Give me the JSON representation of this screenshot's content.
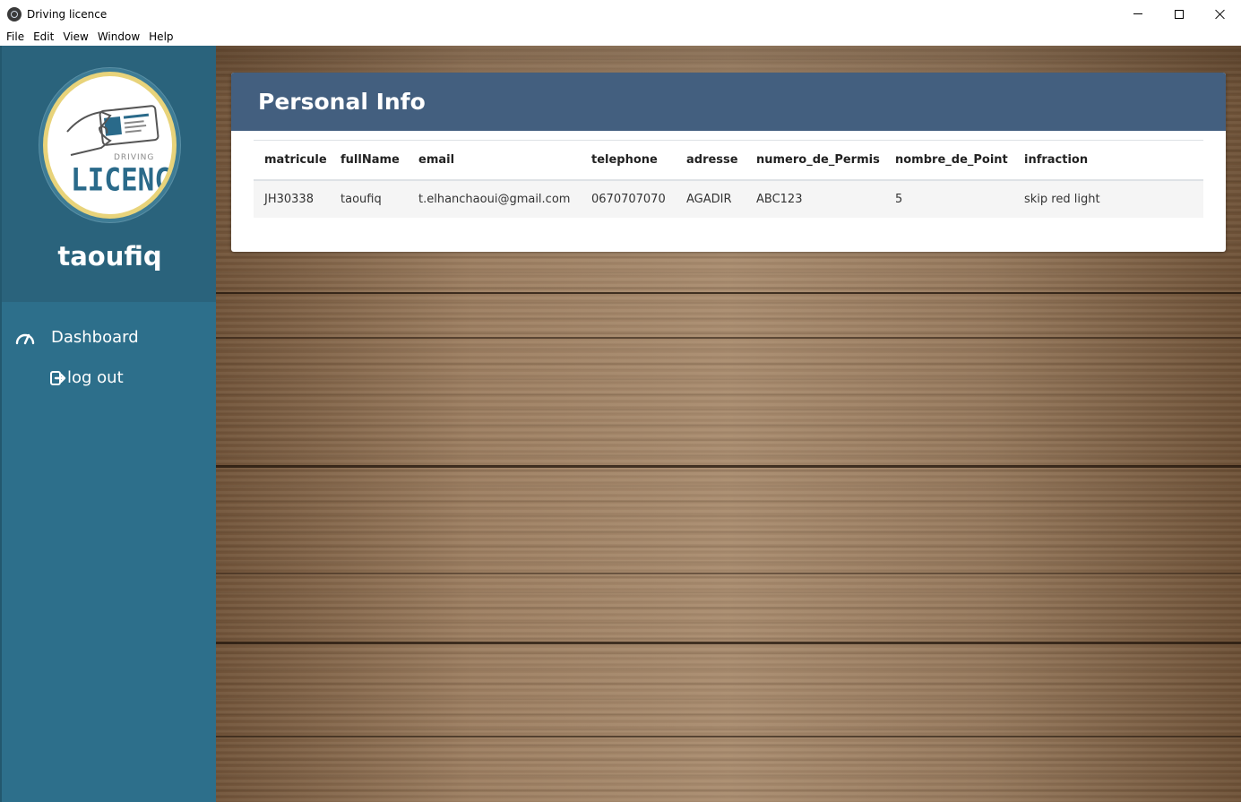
{
  "window": {
    "title": "Driving licence",
    "menu": [
      "File",
      "Edit",
      "View",
      "Window",
      "Help"
    ]
  },
  "sidebar": {
    "logo": {
      "top_text": "DRIVING",
      "main_text": "LICENCE"
    },
    "username": "taoufiq",
    "nav": [
      {
        "label": "Dashboard",
        "icon": "dashboard-gauge-icon"
      },
      {
        "label": "log out",
        "icon": "sign-out-icon"
      }
    ]
  },
  "card": {
    "title": "Personal Info",
    "columns": [
      "matricule",
      "fullName",
      "email",
      "telephone",
      "adresse",
      "numero_de_Permis",
      "nombre_de_Point",
      "infraction"
    ],
    "rows": [
      [
        "JH30338",
        "taoufiq",
        "t.elhanchaoui@gmail.com",
        "0670707070",
        "AGADIR",
        "ABC123",
        "5",
        "skip red light"
      ]
    ]
  },
  "colors": {
    "sidebar": "#2d6f8b",
    "profile": "#2a637c",
    "card_header": "#435f7f",
    "logo_ring": "#e8d37a"
  }
}
